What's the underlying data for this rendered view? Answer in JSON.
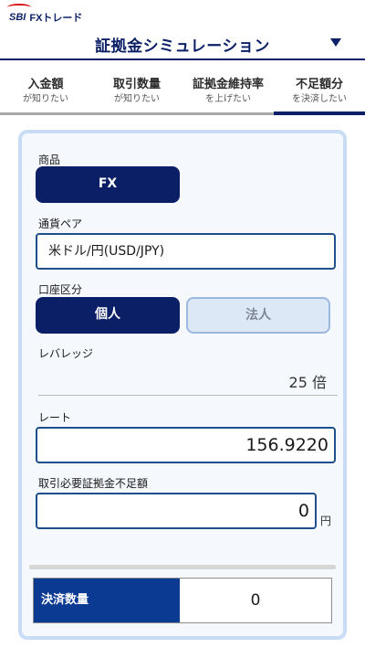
{
  "header": {
    "logo_sbi": "SBI",
    "logo_fx": "FXトレード",
    "title": "証拠金シミュレーション"
  },
  "tabs": [
    {
      "label": "入金額",
      "sub": "が知りたい",
      "active": false
    },
    {
      "label": "取引数量",
      "sub": "が知りたい",
      "active": false
    },
    {
      "label": "証拠金維持率",
      "sub": "を上げたい",
      "active": false
    },
    {
      "label": "不足額分",
      "sub": "を決済したい",
      "active": true
    }
  ],
  "form": {
    "product_label": "商品",
    "product_value": "FX",
    "pair_label": "通貨ペア",
    "pair_value": "米ドル/円(USD/JPY)",
    "account_label": "口座区分",
    "account_options": [
      "個人",
      "法人"
    ],
    "account_selected": "個人",
    "leverage_label": "レバレッジ",
    "leverage_value": "25 倍",
    "rate_label": "レート",
    "rate_value": "156.9220",
    "shortfall_label": "取引必要証拠金不足額",
    "shortfall_value": "0",
    "shortfall_unit": "円"
  },
  "result": {
    "label": "決済数量",
    "value": "0"
  },
  "colors": {
    "brand_navy": "#0b1f66",
    "result_blue": "#0b3a92",
    "panel_border": "#c8dcf4",
    "logo_red": "#d7141a"
  }
}
